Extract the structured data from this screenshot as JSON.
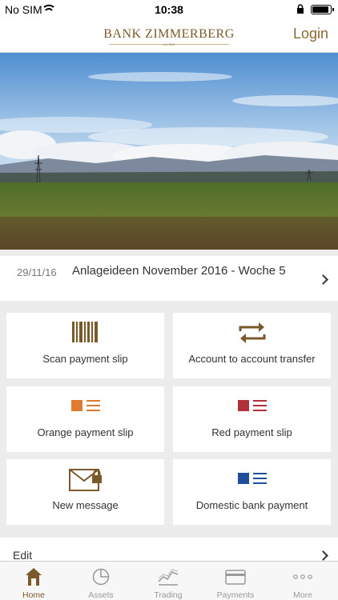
{
  "status_bar": {
    "carrier": "No SIM",
    "time": "10:38",
    "battery_level": 0.95
  },
  "header": {
    "logo": "BANK ZIMMERBERG",
    "logo_sub": "seit 1844",
    "login_label": "Login"
  },
  "hero": {
    "image": "landscape-photo"
  },
  "news": {
    "date": "29/11/16",
    "title": "Anlageideen November 2016 - Woche 5"
  },
  "actions": [
    {
      "label": "Scan payment slip",
      "icon": "barcode-icon"
    },
    {
      "label": "Account to account transfer",
      "icon": "transfer-arrows-icon"
    },
    {
      "label": "Orange payment slip",
      "icon": "orange-slip-icon",
      "color": "#e07a2e"
    },
    {
      "label": "Red payment slip",
      "icon": "red-slip-icon",
      "color": "#b0303a"
    },
    {
      "label": "New message",
      "icon": "message-lock-icon"
    },
    {
      "label": "Domestic bank payment",
      "icon": "blue-slip-icon",
      "color": "#1f4f9a"
    }
  ],
  "edit": {
    "label": "Edit"
  },
  "tabs": [
    {
      "label": "Home",
      "icon": "home-icon",
      "active": true
    },
    {
      "label": "Assets",
      "icon": "pie-chart-icon",
      "active": false
    },
    {
      "label": "Trading",
      "icon": "trading-chart-icon",
      "active": false
    },
    {
      "label": "Payments",
      "icon": "card-icon",
      "active": false
    },
    {
      "label": "More",
      "icon": "more-dots-icon",
      "active": false
    }
  ],
  "colors": {
    "accent": "#7a5a2b",
    "tab_inactive": "#999999",
    "background": "#ececec"
  }
}
